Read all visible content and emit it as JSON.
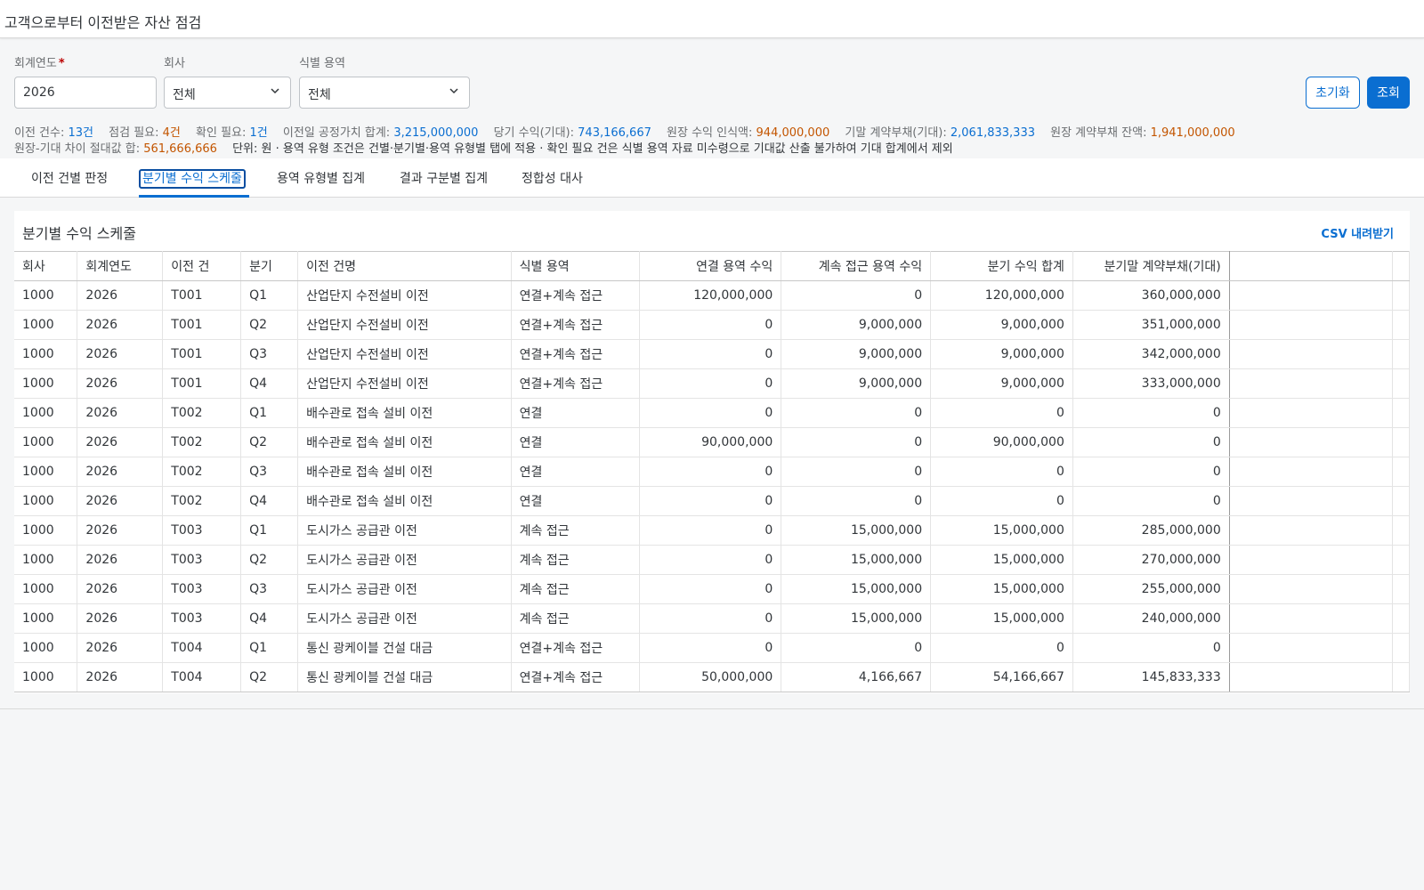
{
  "page": {
    "title": "고객으로부터 이전받은 자산 점검"
  },
  "filters": {
    "fiscal_year": {
      "label": "회계연도",
      "required": "*",
      "value": "2026"
    },
    "company": {
      "label": "회사",
      "value": "전체"
    },
    "service": {
      "label": "식별 용역",
      "value": "전체"
    },
    "reset_label": "초기화",
    "search_label": "조회"
  },
  "stats": {
    "count": {
      "label": "이전 건수:",
      "value": "13건"
    },
    "needs_check": {
      "label": "점검 필요:",
      "value": "4건"
    },
    "needs_confirm": {
      "label": "확인 필요:",
      "value": "1건"
    },
    "fair_value": {
      "label": "이전일 공정가치 합계:",
      "value": "3,215,000,000"
    },
    "revenue_expected": {
      "label": "당기 수익(기대):",
      "value": "743,166,667"
    },
    "ledger_revenue": {
      "label": "원장 수익 인식액:",
      "value": "944,000,000"
    },
    "liability_expected": {
      "label": "기말 계약부채(기대):",
      "value": "2,061,833,333"
    },
    "ledger_liability": {
      "label": "원장 계약부채 잔액:",
      "value": "1,941,000,000"
    },
    "abs_diff": {
      "label": "원장-기대 차이 절대값 합:",
      "value": "561,666,666"
    },
    "note": "단위: 원 · 용역 유형 조건은 건별·분기별·용역 유형별 탭에 적용 · 확인 필요 건은 식별 용역 자료 미수령으로 기대값 산출 불가하여 기대 합계에서 제외"
  },
  "tabs": [
    {
      "label": "이전 건별 판정"
    },
    {
      "label": "분기별 수익 스케줄",
      "active": true
    },
    {
      "label": "용역 유형별 집계"
    },
    {
      "label": "결과 구분별 집계"
    },
    {
      "label": "정합성 대사"
    }
  ],
  "panel": {
    "title": "분기별 수익 스케줄",
    "csv_label": "CSV 내려받기"
  },
  "table": {
    "columns": [
      "회사",
      "회계연도",
      "이전 건",
      "분기",
      "이전 건명",
      "식별 용역",
      "연결 용역 수익",
      "계속 접근 용역 수익",
      "분기 수익 합계",
      "분기말 계약부채(기대)"
    ],
    "rows": [
      [
        "1000",
        "2026",
        "T001",
        "Q1",
        "산업단지 수전설비 이전",
        "연결+계속 접근",
        "120,000,000",
        "0",
        "120,000,000",
        "360,000,000"
      ],
      [
        "1000",
        "2026",
        "T001",
        "Q2",
        "산업단지 수전설비 이전",
        "연결+계속 접근",
        "0",
        "9,000,000",
        "9,000,000",
        "351,000,000"
      ],
      [
        "1000",
        "2026",
        "T001",
        "Q3",
        "산업단지 수전설비 이전",
        "연결+계속 접근",
        "0",
        "9,000,000",
        "9,000,000",
        "342,000,000"
      ],
      [
        "1000",
        "2026",
        "T001",
        "Q4",
        "산업단지 수전설비 이전",
        "연결+계속 접근",
        "0",
        "9,000,000",
        "9,000,000",
        "333,000,000"
      ],
      [
        "1000",
        "2026",
        "T002",
        "Q1",
        "배수관로 접속 설비 이전",
        "연결",
        "0",
        "0",
        "0",
        "0"
      ],
      [
        "1000",
        "2026",
        "T002",
        "Q2",
        "배수관로 접속 설비 이전",
        "연결",
        "90,000,000",
        "0",
        "90,000,000",
        "0"
      ],
      [
        "1000",
        "2026",
        "T002",
        "Q3",
        "배수관로 접속 설비 이전",
        "연결",
        "0",
        "0",
        "0",
        "0"
      ],
      [
        "1000",
        "2026",
        "T002",
        "Q4",
        "배수관로 접속 설비 이전",
        "연결",
        "0",
        "0",
        "0",
        "0"
      ],
      [
        "1000",
        "2026",
        "T003",
        "Q1",
        "도시가스 공급관 이전",
        "계속 접근",
        "0",
        "15,000,000",
        "15,000,000",
        "285,000,000"
      ],
      [
        "1000",
        "2026",
        "T003",
        "Q2",
        "도시가스 공급관 이전",
        "계속 접근",
        "0",
        "15,000,000",
        "15,000,000",
        "270,000,000"
      ],
      [
        "1000",
        "2026",
        "T003",
        "Q3",
        "도시가스 공급관 이전",
        "계속 접근",
        "0",
        "15,000,000",
        "15,000,000",
        "255,000,000"
      ],
      [
        "1000",
        "2026",
        "T003",
        "Q4",
        "도시가스 공급관 이전",
        "계속 접근",
        "0",
        "15,000,000",
        "15,000,000",
        "240,000,000"
      ],
      [
        "1000",
        "2026",
        "T004",
        "Q1",
        "통신 광케이블 건설 대금",
        "연결+계속 접근",
        "0",
        "0",
        "0",
        "0"
      ],
      [
        "1000",
        "2026",
        "T004",
        "Q2",
        "통신 광케이블 건설 대금",
        "연결+계속 접근",
        "50,000,000",
        "4,166,667",
        "54,166,667",
        "145,833,333"
      ]
    ]
  },
  "colors": {
    "accent": "#0a6ed1",
    "orange_value": "#c35500",
    "required": "#bb0000"
  }
}
